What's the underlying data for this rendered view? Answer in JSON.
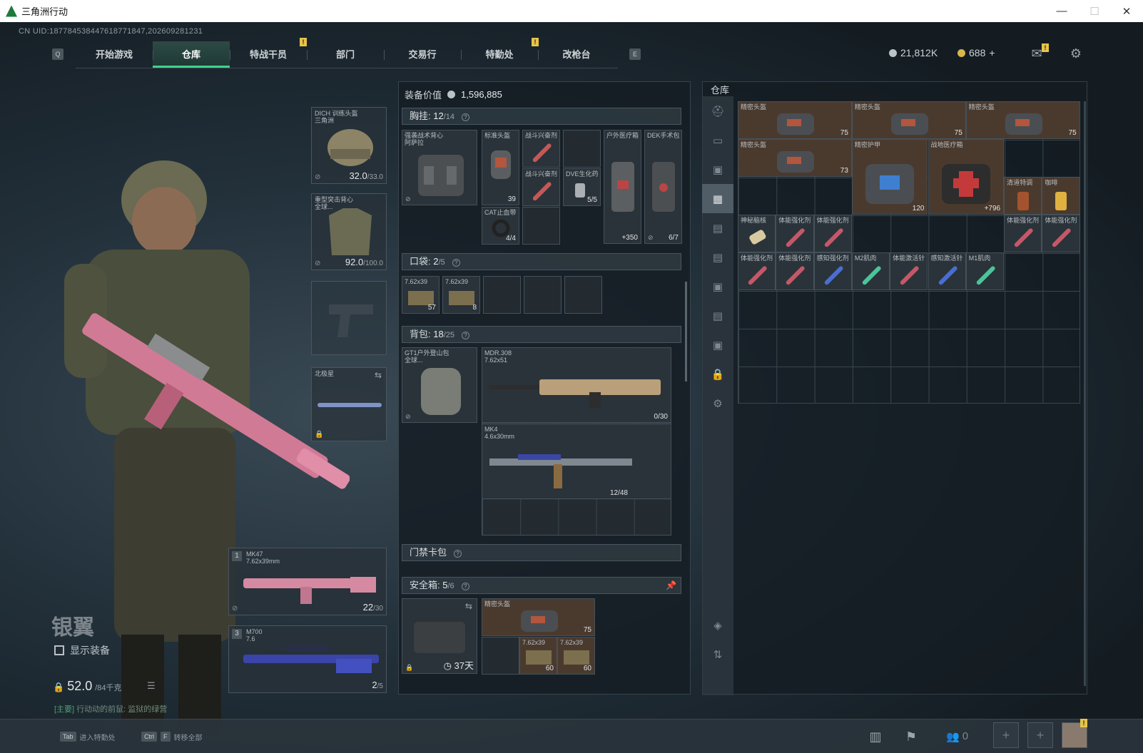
{
  "window": {
    "title": "三角洲行动",
    "minimize": "—",
    "maximize": "☐",
    "close": "✕"
  },
  "uid": "CN UID:187784538447618771847,202609281231",
  "nav": {
    "left_key": "Q",
    "right_key": "E",
    "tabs": [
      "开始游戏",
      "仓库",
      "特战干员",
      "部门",
      "交易行",
      "特勤处",
      "改枪台"
    ],
    "active": "仓库"
  },
  "currency": {
    "silver": "21,812K",
    "gold": "688",
    "gold_plus": "+"
  },
  "icons": {
    "mail": "mail-icon",
    "settings": "gear-icon",
    "notify_badge": "!"
  },
  "loadout": {
    "helmet": {
      "name": "DICH 训练头盔",
      "sub": "三角洲",
      "dur": "32.0",
      "max": "/33.0"
    },
    "armor": {
      "name": "重型突击背心",
      "sub": "全球...",
      "dur": "92.0",
      "max": "/100.0"
    },
    "melee": {
      "name": "北极星"
    },
    "primary": {
      "num": "1",
      "name": "MK47",
      "sub": "7.62x39mm",
      "ammo": "22",
      "max": "/30"
    },
    "secondary": {
      "num": "3",
      "name": "M700",
      "sub": "7.6",
      "ammo": "2",
      "max": "/5"
    }
  },
  "operator": {
    "name": "银翼",
    "show_equipment": "显示装备",
    "weight": "52.0",
    "weight_max": "/84千克",
    "task_tag": "[主要]",
    "task_text": "行动动的前鼠: 监狱的绿营"
  },
  "mid": {
    "value_label": "装备价值",
    "value": "1,596,885",
    "chest": {
      "label": "胸挂:",
      "count": "12",
      "max": "/14"
    },
    "chest_rig": {
      "name": "强袭战术背心",
      "sub": "阿萨拉"
    },
    "chest_items": [
      {
        "name": "标准头盔",
        "val": "39"
      },
      {
        "name": "战斗兴奋剂",
        "val": ""
      },
      {
        "name": "战斗兴奋剂",
        "val": ""
      },
      {
        "name": "DVE生化药",
        "val": "5/5"
      },
      {
        "name": "户外医疗箱",
        "val": "+350"
      },
      {
        "name": "DEK手术包",
        "val": "6/7"
      },
      {
        "name": "CAT止血带",
        "val": "4/4"
      }
    ],
    "pocket": {
      "label": "口袋:",
      "count": "2",
      "max": "/5"
    },
    "pocket_items": [
      {
        "name": "7.62x39",
        "val": "57"
      },
      {
        "name": "7.62x39",
        "val": "8"
      }
    ],
    "backpack": {
      "label": "背包:",
      "count": "18",
      "max": "/25"
    },
    "bag": {
      "name": "GT1户外登山包",
      "sub": "全球..."
    },
    "bag_items": [
      {
        "name": "MDR.308",
        "sub": "7.62x51",
        "val": "0/30"
      },
      {
        "name": "MK4",
        "sub": "4.6x30mm",
        "val": "12/48"
      }
    ],
    "keycard": {
      "label": "门禁卡包"
    },
    "safebox": {
      "label": "安全箱:",
      "count": "5",
      "max": "/6",
      "timer": "37天"
    },
    "safe_items": [
      {
        "name": "精密头盔",
        "val": "75"
      },
      {
        "name": "7.62x39",
        "val": "60"
      },
      {
        "name": "7.62x39",
        "val": "60"
      }
    ]
  },
  "storage": {
    "label": "仓库",
    "items": [
      {
        "name": "精密头盔",
        "val": "75"
      },
      {
        "name": "精密头盔",
        "val": "75"
      },
      {
        "name": "精密头盔",
        "val": "75"
      },
      {
        "name": "精密头盔",
        "val": "73"
      },
      {
        "name": "精密护甲",
        "val": "120"
      },
      {
        "name": "战地医疗箱",
        "val": "+796"
      },
      {
        "name": "清道特调",
        "val": ""
      },
      {
        "name": "咖啡",
        "val": ""
      },
      {
        "name": "神秘脑核",
        "val": ""
      },
      {
        "name": "体能强化剂",
        "val": ""
      },
      {
        "name": "体能强化剂",
        "val": ""
      },
      {
        "name": "体能强化剂",
        "val": ""
      },
      {
        "name": "体能强化剂",
        "val": ""
      },
      {
        "name": "体能强化剂",
        "val": ""
      },
      {
        "name": "体能强化剂",
        "val": ""
      },
      {
        "name": "感知强化剂",
        "val": ""
      },
      {
        "name": "M2肌肉",
        "val": ""
      },
      {
        "name": "体能激活针",
        "val": ""
      },
      {
        "name": "感知激活针",
        "val": ""
      },
      {
        "name": "M1肌肉",
        "val": ""
      }
    ]
  },
  "bottom": {
    "tab_key": "Tab",
    "tab_label": "进入特勤处",
    "ctrl_key": "Ctrl",
    "f_key": "F",
    "transfer_label": "转移全部",
    "friends": "0"
  },
  "colors": {
    "accent": "#3fd28d",
    "brown_cell": "#4a3a2e",
    "badge": "#e7c44a"
  }
}
